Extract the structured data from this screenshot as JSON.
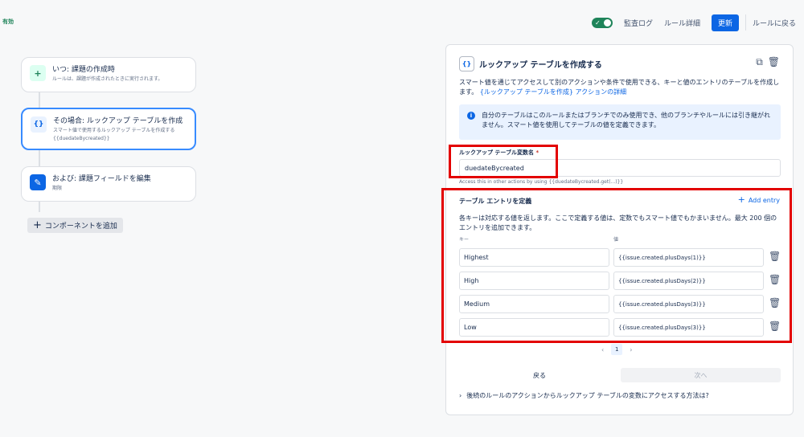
{
  "status": "有効",
  "topbar": {
    "audit_log": "監査ログ",
    "rule_details": "ルール詳細",
    "update": "更新",
    "back_to_rules": "ルールに戻る",
    "toggle_check": "✓"
  },
  "flow": {
    "trigger": {
      "icon": "+",
      "title": "いつ: 課題の作成時",
      "subtitle": "ルールは、課題が作成されたときに実行されます。"
    },
    "condition": {
      "icon": "{}",
      "title": "その場合: ルックアップ テーブルを作成",
      "subtitle": "スマート値で使用するルックアップ テーブルを作成する",
      "subtitle2": "{{duedateBycreated}}"
    },
    "action": {
      "icon": "✎",
      "title": "および: 課題フィールドを編集",
      "subtitle": "期限"
    },
    "add_component": "コンポーネントを追加"
  },
  "panel": {
    "icon": "{}",
    "title": "ルックアップ テーブルを作成する",
    "description": "スマート値を通じてアクセスして別のアクションや条件で使用できる、キーと値のエントリのテーブルを作成します。",
    "desc_link": "{ルックアップ テーブルを作成} アクションの詳細",
    "info": "自分のテーブルはこのルールまたはブランチでのみ使用でき、他のブランチやルールには引き継がれません。スマート値を使用してテーブルの値を定義できます。",
    "info_icon": "i",
    "var_label": "ルックアップ テーブル変数名",
    "var_required": "*",
    "var_value": "duedateBycreated",
    "var_help": "Access this in other actions by using {{duedateBycreated.get(...)}}",
    "entries_title": "テーブル エントリを定義",
    "add_entry": "Add entry",
    "entries_desc": "各キーは対応する値を返します。ここで定義する値は、定数でもスマート値でもかまいません。最大 200 個のエントリを追加できます。",
    "col_key": "キー",
    "col_value": "値",
    "rows": [
      {
        "key": "Highest",
        "value": "{{issue.created.plusDays(1)}}"
      },
      {
        "key": "High",
        "value": "{{issue.created.plusDays(2)}}"
      },
      {
        "key": "Medium",
        "value": "{{issue.created.plusDays(3)}}"
      },
      {
        "key": "Low",
        "value": "{{issue.created.plusDays(3)}}"
      }
    ],
    "pager": {
      "prev": "‹",
      "page": "1",
      "next": "›"
    },
    "back": "戻る",
    "next": "次へ",
    "faq": "後続のルールのアクションからルックアップ テーブルの変数にアクセスする方法は?"
  }
}
